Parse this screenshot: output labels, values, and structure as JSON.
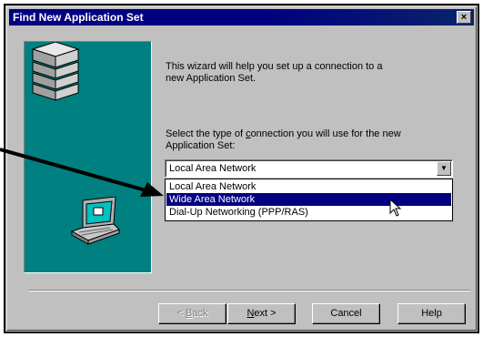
{
  "window": {
    "title": "Find New Application Set",
    "close_glyph": "×"
  },
  "wizard": {
    "intro_text": "This wizard will help you set up a connection to a\nnew Application Set.",
    "prompt_before": "Select the type of ",
    "prompt_accel": "c",
    "prompt_after": "onnection you will use for the new\nApplication Set:"
  },
  "combo": {
    "selected_value": "Local Area Network",
    "options": [
      {
        "label": "Local Area Network",
        "selected": false
      },
      {
        "label": "Wide Area Network",
        "selected": true
      },
      {
        "label": "Dial-Up Networking (PPP/RAS)",
        "selected": false
      }
    ]
  },
  "buttons": {
    "back_accel": "B",
    "back_rest": "ack",
    "back_prefix": "< ",
    "next_accel": "N",
    "next_rest": "ext >",
    "cancel": "Cancel",
    "help": "Help"
  },
  "colors": {
    "title_bar": "#000080",
    "panel": "#008080",
    "selection": "#000080",
    "face": "#c0c0c0"
  },
  "icons": [
    "server-stack-icon",
    "laptop-icon",
    "mouse-cursor-icon",
    "callout-arrow"
  ]
}
